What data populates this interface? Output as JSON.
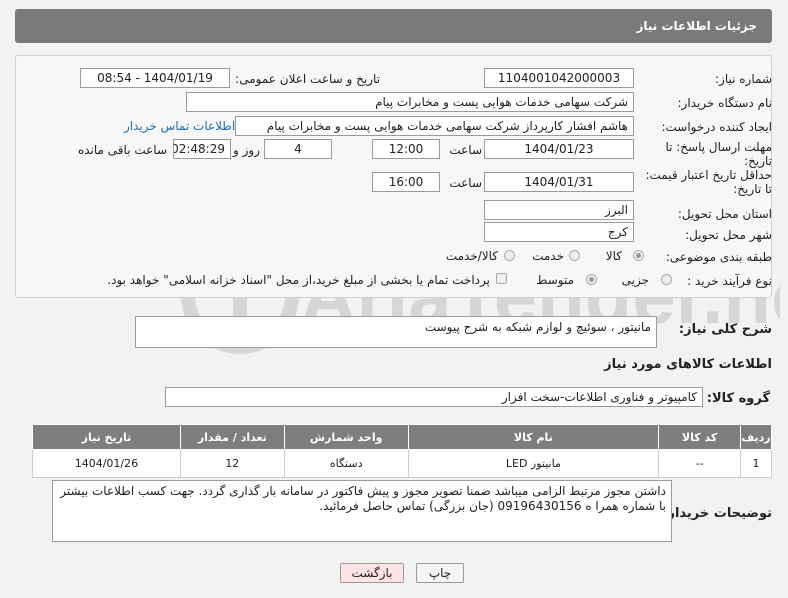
{
  "header": {
    "title": "جزئیات اطلاعات نیاز"
  },
  "fields": {
    "need_number_label": "شماره نیاز:",
    "need_number": "1104001042000003",
    "announce_label": "تاریخ و ساعت اعلان عمومی:",
    "announce_value": "1404/01/19 - 08:54",
    "buyer_org_label": "نام دستگاه خریدار:",
    "buyer_org": "شرکت سهامی خدمات هوایی پست و مخابرات پیام",
    "requester_label": "ایجاد کننده درخواست:",
    "requester": "هاشم افشار کارپرداز شرکت سهامی خدمات هوایی پست و مخابرات پیام",
    "contact_link": "اطلاعات تماس خریدار",
    "deadline_label_1": "مهلت ارسال پاسخ: تا",
    "deadline_label_2": "تاریخ:",
    "deadline_date": "1404/01/23",
    "time_label": "ساعت",
    "deadline_time": "12:00",
    "days_value": "4",
    "days_label": "روز و",
    "remaining_time": "02:48:29",
    "remaining_label": "ساعت باقی مانده",
    "validity_label_1": "حداقل تاریخ اعتبار قیمت:",
    "validity_label_2": "تا تاریخ:",
    "validity_date": "1404/01/31",
    "validity_time": "16:00",
    "province_label": "استان محل تحویل:",
    "province": "البرز",
    "city_label": "شهر محل تحویل:",
    "city": "کرج",
    "category_label": "طبقه بندی موضوعی:",
    "category_options": [
      "کالا",
      "خدمت",
      "کالا/خدمت"
    ],
    "process_label": "نوع فرآیند خرید :",
    "process_options": [
      "جزیی",
      "متوسط"
    ],
    "payment_note": "پرداخت تمام یا بخشی از مبلغ خرید،از محل \"اسناد خزانه اسلامی\" خواهد بود."
  },
  "summary": {
    "label": "شرح کلی نیاز:",
    "value": "مانیتور  ، سوئیچ و لوازم شبکه به شرح پیوست"
  },
  "goods_section": {
    "title": "اطلاعات کالاهای مورد نیاز",
    "group_label": "گروه کالا:",
    "group_value": "کامپیوتر و فناوری اطلاعات-سخت افزار"
  },
  "table": {
    "headers": [
      "ردیف",
      "کد کالا",
      "نام کالا",
      "واحد شمارش",
      "تعداد / مقدار",
      "تاریخ نیاز"
    ],
    "rows": [
      [
        "1",
        "--",
        "مانیتور LED",
        "دستگاه",
        "12",
        "1404/01/26"
      ]
    ]
  },
  "buyer_notes": {
    "label": "توضیحات خریدار:",
    "value": "داشتن مجوز مرتبط الزامی میباشد ضمنا تصویر مجوز  و پیش فاکتور در سامانه بار گذاری گردد. جهت کسب اطلاعات بیشتر با شماره همرا ه  09196430156 (جان بزرگی) تماس حاصل فرمائید."
  },
  "buttons": {
    "print": "چاپ",
    "back": "بازگشت"
  },
  "watermark": {
    "text": "AriaTender.neT"
  }
}
